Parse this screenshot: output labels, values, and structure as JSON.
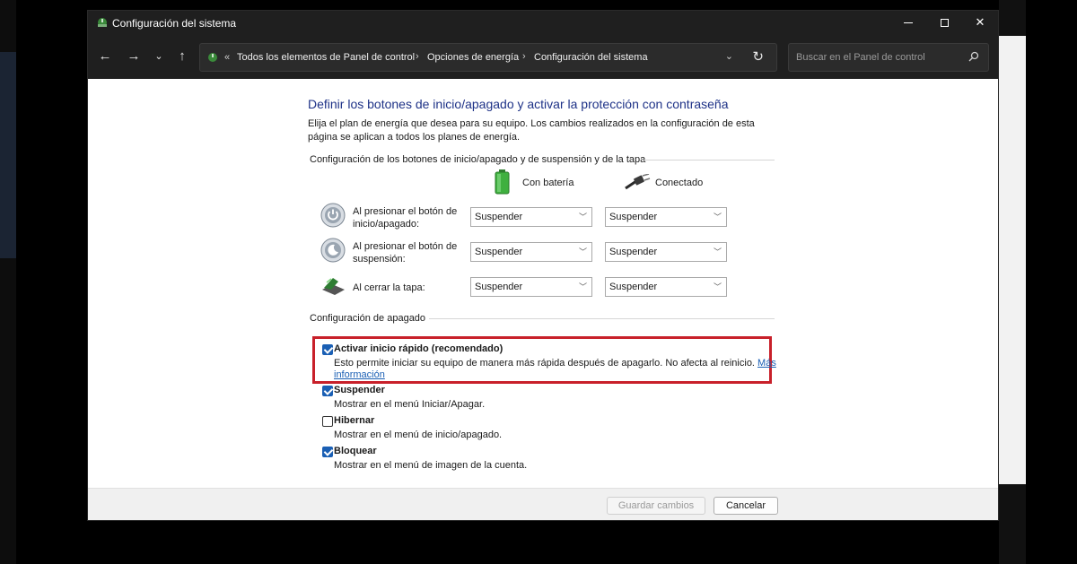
{
  "window": {
    "title": "Configuración del sistema"
  },
  "nav": {
    "back_label": "←",
    "forward_label": "→",
    "recent_label": "⌄",
    "up_label": "↑",
    "address_prefix": "«",
    "breadcrumbs": [
      "Todos los elementos de Panel de control",
      "Opciones de energía",
      "Configuración del sistema"
    ],
    "search_placeholder": "Buscar en el Panel de control"
  },
  "page": {
    "title": "Definir los botones de inicio/apagado y activar la protección con contraseña",
    "description": "Elija el plan de energía que desea para su equipo. Los cambios realizados en la configuración de esta página se aplican a todos los planes de energía."
  },
  "buttons_section": {
    "heading": "Configuración de los botones de inicio/apagado y de suspensión y de la tapa",
    "col_battery": "Con batería",
    "col_plugged": "Conectado",
    "rows": [
      {
        "label_line1": "Al presionar el botón de",
        "label_line2": "inicio/apagado:",
        "battery": "Suspender",
        "plugged": "Suspender",
        "icon": "power-button-icon"
      },
      {
        "label_line1": "Al presionar el botón de",
        "label_line2": "suspensión:",
        "battery": "Suspender",
        "plugged": "Suspender",
        "icon": "sleep-button-icon"
      },
      {
        "label_line1": "Al cerrar la tapa:",
        "label_line2": "",
        "battery": "Suspender",
        "plugged": "Suspender",
        "icon": "laptop-lid-icon"
      }
    ]
  },
  "shutdown_section": {
    "heading": "Configuración de apagado",
    "options": [
      {
        "label": "Activar inicio rápido (recomendado)",
        "checked": true,
        "desc_line1": "Esto permite iniciar su equipo de manera más rápida después de apagarlo. No afecta al reinicio. ",
        "link_part1": "Más",
        "link_part2": "información"
      },
      {
        "label": "Suspender",
        "checked": true,
        "desc_line1": "Mostrar en el menú Iniciar/Apagar."
      },
      {
        "label": "Hibernar",
        "checked": false,
        "desc_line1": "Mostrar en el menú de inicio/apagado."
      },
      {
        "label": "Bloquear",
        "checked": true,
        "desc_line1": "Mostrar en el menú de imagen de la cuenta."
      }
    ]
  },
  "footer": {
    "save_label": "Guardar cambios",
    "cancel_label": "Cancelar"
  },
  "colors": {
    "title_blue": "#1e3287",
    "link_blue": "#1a5fb4",
    "highlight_red": "#c8202a",
    "titlebar": "#1f1f1f"
  }
}
